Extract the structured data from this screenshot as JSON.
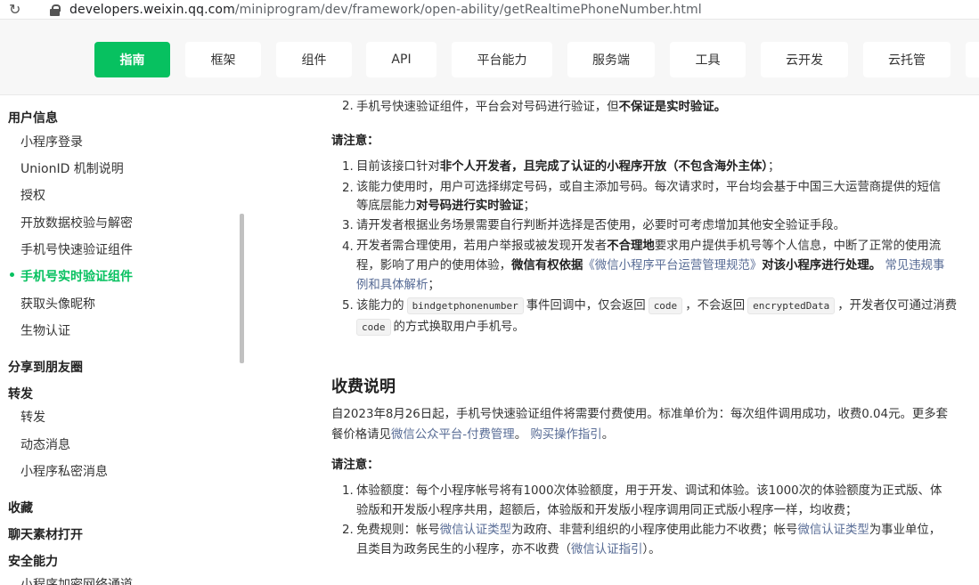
{
  "browser": {
    "url_host": "developers.weixin.qq.com",
    "url_path": "/miniprogram/dev/framework/open-ability/getRealtimePhoneNumber.html"
  },
  "nav": {
    "tabs": [
      "指南",
      "框架",
      "组件",
      "API",
      "平台能力",
      "服务端",
      "工具",
      "云开发",
      "云托管"
    ],
    "active": "指南"
  },
  "sidebar": {
    "section_user": "用户信息",
    "items_user": [
      "小程序登录",
      "UnionID 机制说明",
      "授权",
      "开放数据校验与解密",
      "手机号快速验证组件",
      "手机号实时验证组件",
      "获取头像昵称",
      "生物认证"
    ],
    "active_item": "手机号实时验证组件",
    "section_share": "分享到朋友圈",
    "section_forward": "转发",
    "items_forward": [
      "转发",
      "动态消息",
      "小程序私密消息"
    ],
    "section_fav": "收藏",
    "section_chat": "聊天素材打开",
    "section_security": "安全能力",
    "partial_item": "小程序加密网络通道"
  },
  "content": {
    "item2_top": "手机号快速验证组件，平台会对号码进行验证，但",
    "item2_top_bold": "不保证是实时验证。",
    "note1_label": "请注意：",
    "n1_a": "目前该接口针对",
    "n1_b": "非个人开发者，且完成了认证的小程序开放（不包含海外主体）",
    "n1_c": "；",
    "n2_a": "该能力使用时，用户可选择绑定号码，或自主添加号码。每次请求时，平台均会基于中国三大运营商提供的短信",
    "n2_b": "等底层能力",
    "n2_c": "对号码进行实时验证",
    "n2_d": "；",
    "n3": "请开发者根据业务场景需要自行判断并选择是否使用，必要时可考虑增加其他安全验证手段。",
    "n4_a": "开发者需合理使用，若用户举报或被发现开发者",
    "n4_b": "不合理地",
    "n4_c": "要求用户提供手机号等个人信息，中断了正常的使用流",
    "n4_d": "程，影响了用户的使用体验，",
    "n4_e": "微信有权依据",
    "n4_link": "《微信小程序平台运营管理规范》",
    "n4_f": "对该小程序进行处理。",
    "n4_link2a": "常见违规事",
    "n4_link2b": "例和具体解析",
    "n4_g": "；",
    "n5_a": "该能力的",
    "n5_code1": "bindgetphonenumber",
    "n5_b": "事件回调中，仅会返回",
    "n5_code2": "code",
    "n5_c": "，不会返回",
    "n5_code3": "encryptedData",
    "n5_d": "，开发者仅可通过消费",
    "n5_code4": "code",
    "n5_e": "的方式换取用户手机号。",
    "fee_title": "收费说明",
    "fee_a": "自2023年8月26日起，手机号快速验证组件将需要付费使用。标准单价为：每次组件调用成功，收费0.04元。更多套",
    "fee_b": "餐价格请见",
    "fee_link1": "微信公众平台-付费管理",
    "fee_c": "。",
    "fee_link2": "购买操作指引",
    "fee_d": "。",
    "note2_label": "请注意：",
    "f1_a": "体验额度：每个小程序帐号将有1000次体验额度，用于开发、调试和体验。该1000次的体验额度为正式版、体",
    "f1_b": "验版和开发版小程序共用，超额后，体验版和开发版小程序调用同正式版小程序一样，均收费；",
    "f2_a": "免费规则：帐号",
    "f2_link1": "微信认证类型",
    "f2_b": "为政府、非营利组织的小程序使用此能力不收费；帐号",
    "f2_link2": "微信认证类型",
    "f2_c": "为事业单位，",
    "f2_d": "且类目为政务民生的小程序，亦不收费（",
    "f2_link3": "微信认证指引",
    "f2_e": "）。"
  }
}
